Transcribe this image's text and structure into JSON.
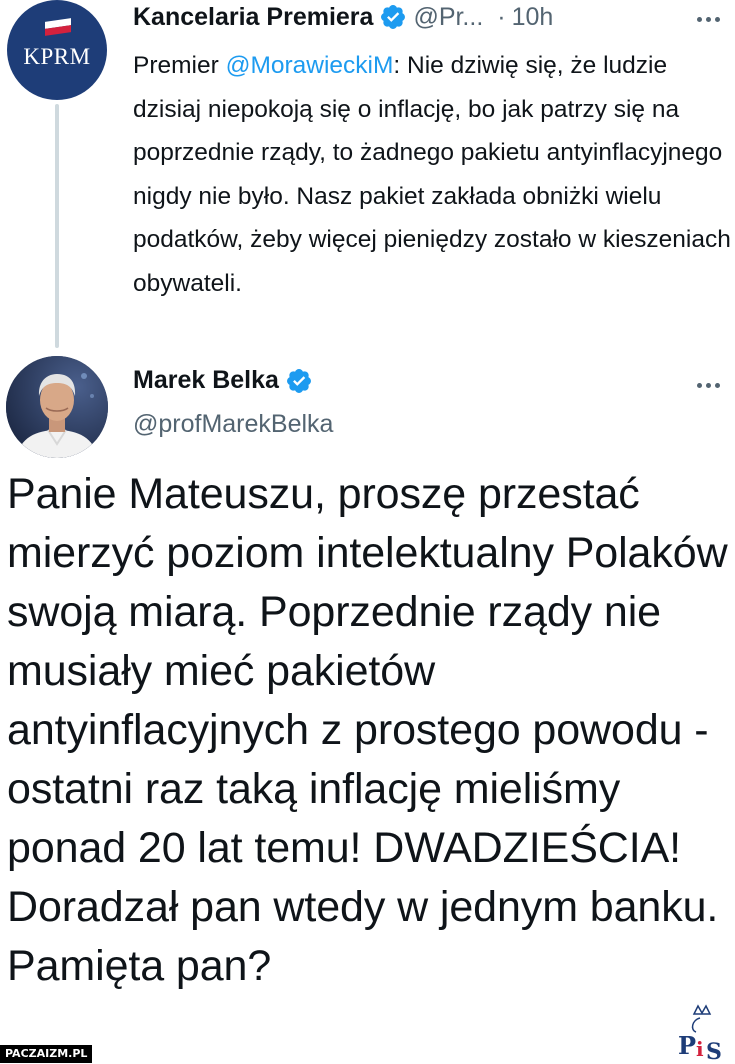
{
  "parent_tweet": {
    "avatar_text": "KPRM",
    "display_name": "Kancelaria Premiera",
    "handle": "@Pr...",
    "dot": "·",
    "time": "10h",
    "body_prefix": "Premier ",
    "mention": "@MorawieckiM",
    "body_rest": ": Nie dziwię się, że ludzie dzisiaj niepokoją się o inflację, bo jak patrzy się na poprzednie rządy, to żadnego pakietu antyinflacyjnego nigdy nie było. Nasz pakiet zakłada obniżki wielu podatków, żeby więcej pieniędzy zostało w kieszeniach obywateli."
  },
  "main_tweet": {
    "display_name": "Marek Belka",
    "handle": "@profMarekBelka",
    "body": "Panie Mateuszu, proszę przestać mierzyć poziom intelektualny Polaków swoją miarą. Poprzednie rządy nie musiały mieć pakietów antyinflacyjnych z prostego powodu - ostatni raz taką inflację mieliśmy ponad 20 lat temu! DWADZIEŚCIA! Doradzał pan wtedy w jednym banku. Pamięta pan?"
  },
  "watermarks": {
    "site": "PACZAIZM.PL",
    "logo_text": "PiS"
  },
  "colors": {
    "accent": "#1d9bf0",
    "text": "#0f1419",
    "secondary": "#536471",
    "thread_line": "#cfd9de",
    "kprm_navy": "#1e3d78"
  },
  "icons": {
    "verified": "verified-badge-icon",
    "more": "more-horizontal-icon"
  }
}
